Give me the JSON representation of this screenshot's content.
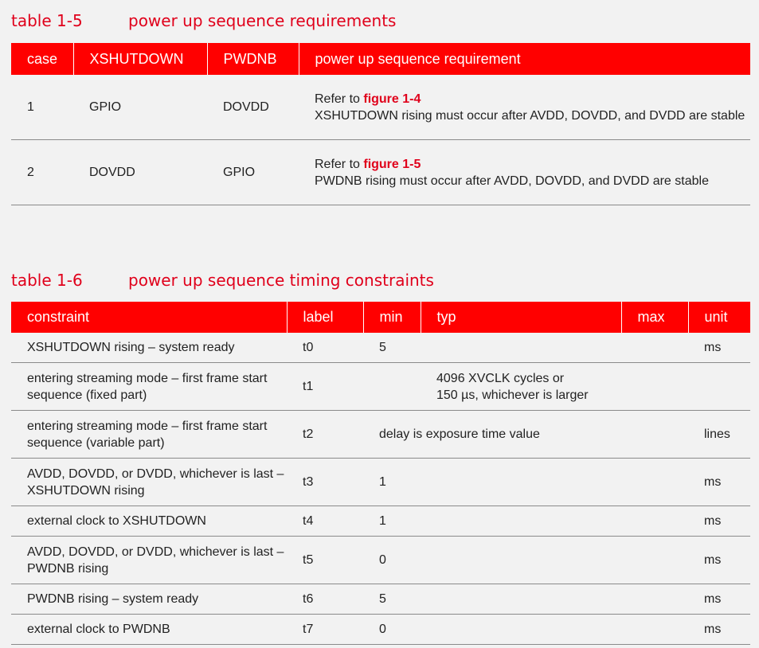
{
  "table1": {
    "caption_num": "table 1-5",
    "caption_title": "power up sequence requirements",
    "headers": [
      "case",
      "XSHUTDOWN",
      "PWDNB",
      "power up sequence requirement"
    ],
    "rows": [
      {
        "case": "1",
        "xshutdown": "GPIO",
        "pwdnb": "DOVDD",
        "refer_prefix": "Refer to ",
        "refer_link": "figure 1-4",
        "requirement": "XSHUTDOWN rising must occur after AVDD, DOVDD, and DVDD are stable"
      },
      {
        "case": "2",
        "xshutdown": "DOVDD",
        "pwdnb": "GPIO",
        "refer_prefix": "Refer to ",
        "refer_link": "figure 1-5",
        "requirement": "PWDNB rising must occur after AVDD, DOVDD, and DVDD are stable"
      }
    ]
  },
  "table2": {
    "caption_num": "table 1-6",
    "caption_title": "power up sequence timing constraints",
    "headers": [
      "constraint",
      "label",
      "min",
      "typ",
      "max",
      "unit"
    ],
    "rows": [
      {
        "constraint": "XSHUTDOWN rising – system ready",
        "label": "t0",
        "min": "5",
        "typ": "",
        "max": "",
        "unit": "ms"
      },
      {
        "constraint": "entering streaming mode – first frame start sequence (fixed part)",
        "label": "t1",
        "span_line1": "4096 XVCLK cycles or",
        "span_line2": "150 µs, whichever is larger",
        "unit": ""
      },
      {
        "constraint": "entering streaming mode – first frame start sequence (variable part)",
        "label": "t2",
        "span_text": "delay is exposure time value",
        "unit": "lines"
      },
      {
        "constraint": "AVDD, DOVDD, or DVDD, whichever is last – XSHUTDOWN rising",
        "label": "t3",
        "min": "1",
        "typ": "",
        "max": "",
        "unit": "ms"
      },
      {
        "constraint": "external clock to XSHUTDOWN",
        "label": "t4",
        "min": "1",
        "typ": "",
        "max": "",
        "unit": "ms"
      },
      {
        "constraint": "AVDD, DOVDD, or DVDD, whichever is last – PWDNB rising",
        "label": "t5",
        "min": "0",
        "typ": "",
        "max": "",
        "unit": "ms"
      },
      {
        "constraint": "PWDNB rising – system ready",
        "label": "t6",
        "min": "5",
        "typ": "",
        "max": "",
        "unit": "ms"
      },
      {
        "constraint": "external clock to PWDNB",
        "label": "t7",
        "min": "0",
        "typ": "",
        "max": "",
        "unit": "ms"
      }
    ]
  },
  "colors": {
    "accent": "#ff0000",
    "caption": "#e0001b"
  }
}
